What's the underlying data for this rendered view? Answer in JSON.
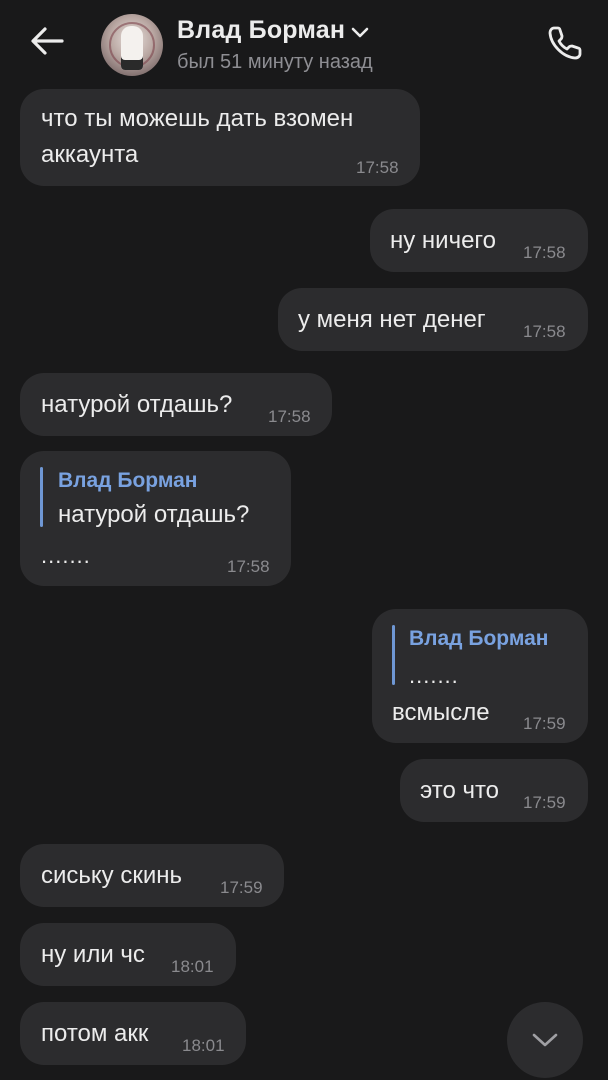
{
  "header": {
    "contact_name": "Влад Борман",
    "status": "был 51 минуту назад"
  },
  "icons": {
    "back": "arrow-left-icon",
    "chevron": "chevron-down-icon",
    "call": "phone-icon",
    "scroll": "chevron-down-icon"
  },
  "messages": [
    {
      "side": "in",
      "text_line1": "что ты можешь дать взомен",
      "text_line2": "аккаунта",
      "time": "17:58"
    },
    {
      "side": "out",
      "text": "ну ничего",
      "time": "17:58"
    },
    {
      "side": "out",
      "text": "у меня нет денег",
      "time": "17:58"
    },
    {
      "side": "in",
      "text": "натурой отдашь?",
      "time": "17:58"
    },
    {
      "side": "in",
      "reply_name": "Влад Борман",
      "reply_text": "натурой отдашь?",
      "text": ".......",
      "time": "17:58"
    },
    {
      "side": "out",
      "reply_name": "Влад Борман",
      "reply_text": ".......",
      "text": "всмысле",
      "time": "17:59"
    },
    {
      "side": "out",
      "text": "это что",
      "time": "17:59"
    },
    {
      "side": "in",
      "text": "сиську скинь",
      "time": "17:59"
    },
    {
      "side": "in",
      "text": "ну или чс",
      "time": "18:01"
    },
    {
      "side": "in",
      "text": "потом акк",
      "time": "18:01"
    }
  ],
  "colors": {
    "background": "#19191a",
    "bubble": "#2c2c2e",
    "text": "#ececec",
    "time": "#8a8a8e",
    "reply_accent": "#79a2e0"
  }
}
